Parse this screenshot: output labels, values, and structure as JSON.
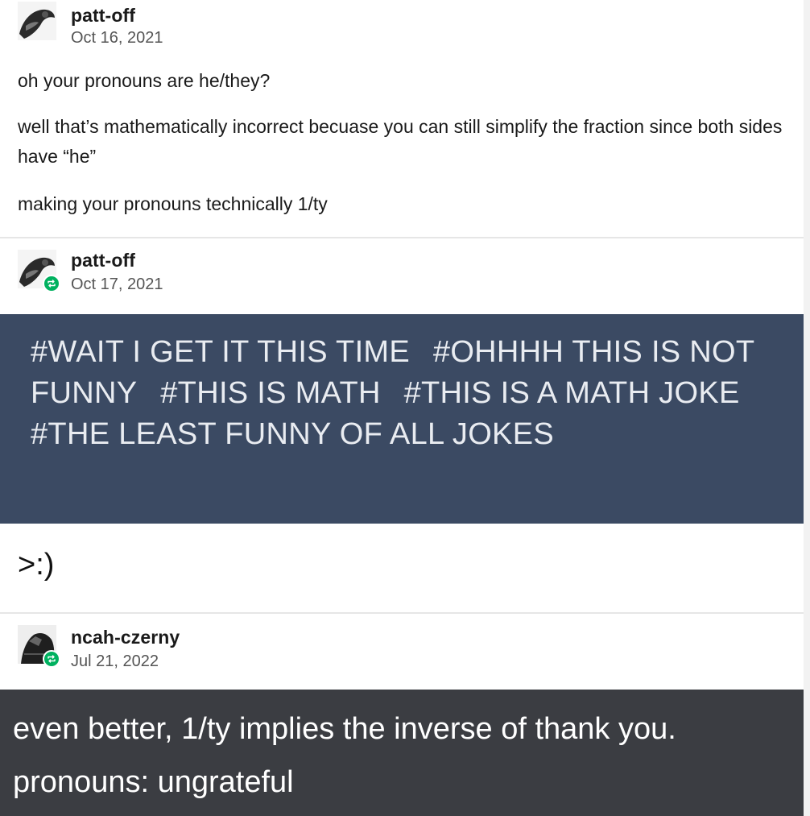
{
  "posts": [
    {
      "author": "patt-off",
      "date": "Oct 16, 2021",
      "avatar_icon": "avatar-image-icon",
      "reblog": false,
      "paragraphs": [
        "oh your pronouns are he/they?",
        "well that’s mathematically incorrect becuase you can still simplify the fraction since both sides have “he”",
        "making your pronouns technically 1/ty"
      ]
    },
    {
      "author": "patt-off",
      "date": "Oct 17, 2021",
      "avatar_icon": "avatar-image-icon",
      "reblog": true,
      "reblog_icon": "reblog-icon",
      "tags": [
        "#WAIT I GET IT THIS TIME",
        "#OHHHH THIS IS NOT FUNNY",
        "#THIS IS MATH",
        "#THIS IS A MATH JOKE",
        "#THE LEAST FUNNY OF ALL JOKES"
      ],
      "text": ">:)"
    },
    {
      "author": "ncah-czerny",
      "date": "Jul 21, 2022",
      "avatar_icon": "avatar-image-icon",
      "reblog": true,
      "reblog_icon": "reblog-icon",
      "highlighted_text": "even better, 1/ty implies the inverse of thank you. pronouns: ungrateful"
    }
  ],
  "colors": {
    "tags_background": "#3b4a63",
    "quote_background": "#3b3d42",
    "reblog_badge": "#00b15f"
  }
}
